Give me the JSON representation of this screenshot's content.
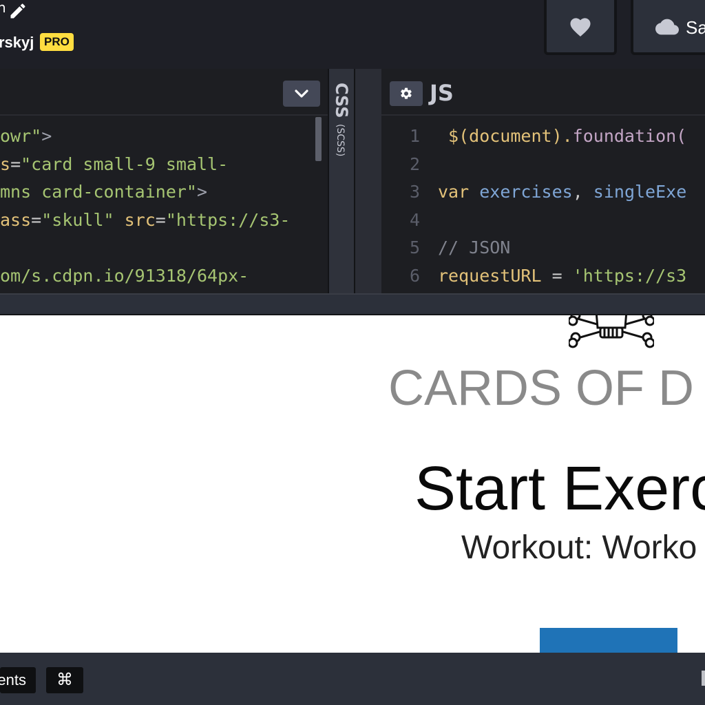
{
  "header": {
    "title_fragment": "n",
    "username": "rskyj",
    "pro_badge": "PRO",
    "save_label": "Sa"
  },
  "editors": {
    "html": {
      "lines": [
        [
          {
            "t": "owr\"",
            "c": "#a6c572"
          },
          {
            "t": ">",
            "c": "#9ea1ac"
          }
        ],
        [
          {
            "t": "s",
            "c": "#e3c279"
          },
          {
            "t": "=",
            "c": "#c9c9c9"
          },
          {
            "t": "\"card small-9 small-",
            "c": "#a6c572"
          }
        ],
        [
          {
            "t": "mns card-container\"",
            "c": "#a6c572"
          },
          {
            "t": ">",
            "c": "#9ea1ac"
          }
        ],
        [
          {
            "t": "ass",
            "c": "#e3c279"
          },
          {
            "t": "=",
            "c": "#c9c9c9"
          },
          {
            "t": "\"skull\"",
            "c": "#a6c572"
          },
          {
            "t": " ",
            "c": "#c9c9c9"
          },
          {
            "t": "src",
            "c": "#e3c279"
          },
          {
            "t": "=",
            "c": "#c9c9c9"
          },
          {
            "t": "\"https://s3-",
            "c": "#a6c572"
          }
        ],
        [
          {
            "t": "",
            "c": "#c9c9c9"
          }
        ],
        [
          {
            "t": "om/s.cdpn.io/91318/64px-",
            "c": "#a6c572"
          }
        ]
      ]
    },
    "css": {
      "label": "CSS",
      "sublabel": "(SCSS)"
    },
    "js": {
      "title": "JS",
      "line_numbers": [
        "1",
        "2",
        "3",
        "4",
        "5",
        "6"
      ],
      "lines": [
        [
          {
            "t": " $(document).",
            "c": "#e3c279"
          },
          {
            "t": "foundation(",
            "c": "#c4a6c6"
          }
        ],
        [
          {
            "t": "",
            "c": "#c9c9c9"
          }
        ],
        [
          {
            "t": "var ",
            "c": "#e3c279"
          },
          {
            "t": "exercises",
            "c": "#7fa6d6"
          },
          {
            "t": ", ",
            "c": "#c9c9c9"
          },
          {
            "t": "singleExe",
            "c": "#7fa6d6"
          }
        ],
        [
          {
            "t": "",
            "c": "#c9c9c9"
          }
        ],
        [
          {
            "t": "// JSON",
            "c": "#80838e"
          }
        ],
        [
          {
            "t": "requestURL",
            "c": "#e3c279"
          },
          {
            "t": " = ",
            "c": "#c9c9c9"
          },
          {
            "t": "'https://s3",
            "c": "#a6c572"
          }
        ]
      ]
    }
  },
  "preview": {
    "heading": "CARDS OF D",
    "title": "Start Exerc",
    "subtitle": "Workout: Worko"
  },
  "footer": {
    "comments_label": "ents",
    "shortcut_symbol": "⌘"
  },
  "colors": {
    "pro_badge": "#ffdd40",
    "preview_button": "#1f73b7",
    "editor_bg": "#1d1e22",
    "chrome_bg": "#2c303a"
  }
}
